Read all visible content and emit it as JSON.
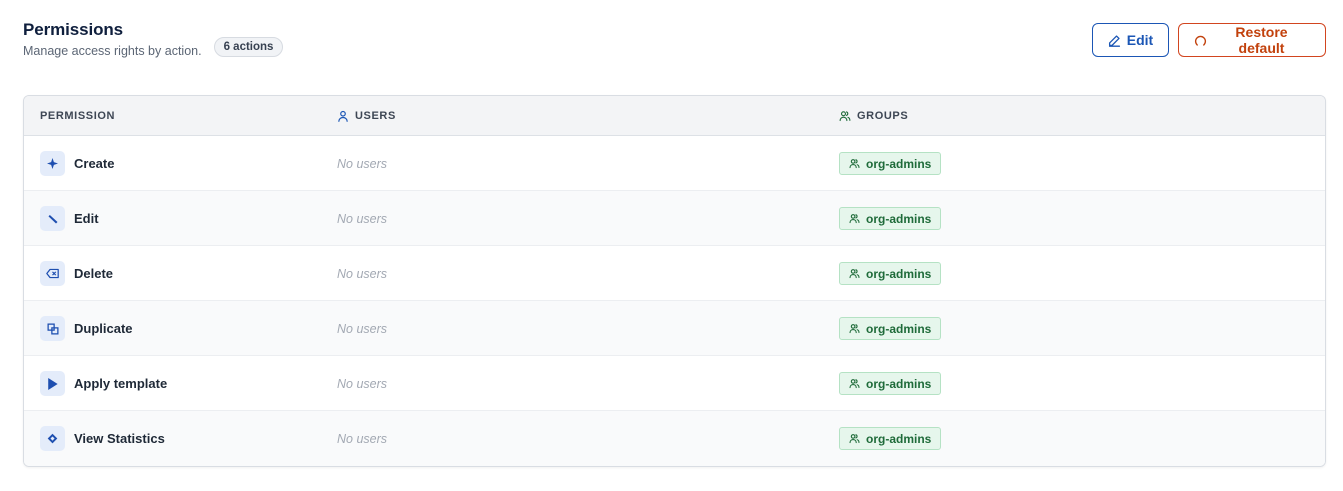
{
  "header": {
    "title": "Permissions",
    "subtitle": "Manage access rights by action.",
    "badge": "6 actions"
  },
  "toolbar": {
    "edit_label": "Edit",
    "restore_label": "Restore default"
  },
  "colors": {
    "primary": "#1b56b5",
    "danger": "#c2410c",
    "group_chip_bg": "#e6f6ec",
    "group_chip_text": "#1f6b3a"
  },
  "table": {
    "columns": [
      "PERMISSION",
      "USERS",
      "GROUPS"
    ],
    "rows": [
      {
        "icon": "sparkle-icon",
        "permission": "Create",
        "users": "No users",
        "group": "org-admins"
      },
      {
        "icon": "pencil-icon",
        "permission": "Edit",
        "users": "No users",
        "group": "org-admins"
      },
      {
        "icon": "backspace-icon",
        "permission": "Delete",
        "users": "No users",
        "group": "org-admins"
      },
      {
        "icon": "copy-icon",
        "permission": "Duplicate",
        "users": "No users",
        "group": "org-admins"
      },
      {
        "icon": "play-icon",
        "permission": "Apply template",
        "users": "No users",
        "group": "org-admins"
      },
      {
        "icon": "diamond-icon",
        "permission": "View Statistics",
        "users": "No users",
        "group": "org-admins"
      }
    ]
  }
}
